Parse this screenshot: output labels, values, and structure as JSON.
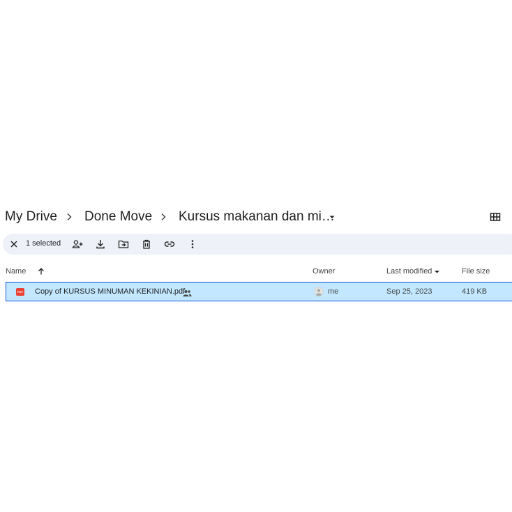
{
  "breadcrumb": {
    "items": [
      {
        "label": "My Drive"
      },
      {
        "label": "Done Move"
      },
      {
        "label": "Kursus makanan dan mi…"
      }
    ],
    "view_toggle_icon": "grid-view-icon"
  },
  "toolbar": {
    "selected_label": "1 selected",
    "actions": [
      {
        "name": "clear-selection",
        "icon": "close-icon"
      },
      {
        "name": "share",
        "icon": "person-add-icon"
      },
      {
        "name": "download",
        "icon": "download-icon"
      },
      {
        "name": "move",
        "icon": "folder-move-icon"
      },
      {
        "name": "delete",
        "icon": "trash-icon"
      },
      {
        "name": "copy-link",
        "icon": "link-icon"
      },
      {
        "name": "more-actions",
        "icon": "more-vert-icon"
      }
    ]
  },
  "columns": {
    "name": "Name",
    "owner": "Owner",
    "last_modified": "Last modified",
    "file_size": "File size"
  },
  "files": [
    {
      "icon": "pdf-icon",
      "type_badge": "PDF",
      "name": "Copy of KURSUS MINUMAN KEKINIAN.pdf",
      "shared": true,
      "owner": "me",
      "last_modified": "Sep 25, 2023",
      "size": "419 KB",
      "selected": true
    }
  ],
  "colors": {
    "toolbar_bg": "#eef2f8",
    "selected_row_bg": "#c2e7ff",
    "selected_row_border": "#0b57d0",
    "pdf_red": "#e94235"
  }
}
